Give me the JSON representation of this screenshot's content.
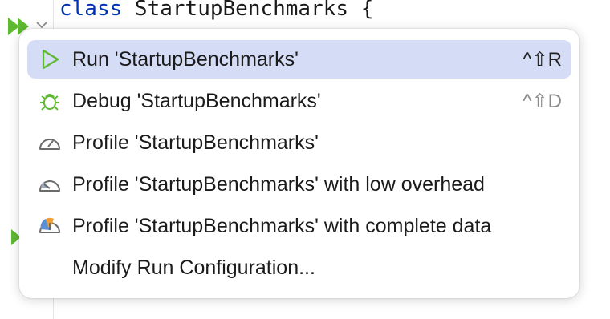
{
  "editor": {
    "code_keyword": "class",
    "code_rest": " StartupBenchmarks {",
    "closing_brace": "}"
  },
  "menu": {
    "items": [
      {
        "label": "Run 'StartupBenchmarks'",
        "shortcut": "^⇧R",
        "icon": "run-icon"
      },
      {
        "label": "Debug 'StartupBenchmarks'",
        "shortcut": "^⇧D",
        "icon": "debug-icon"
      },
      {
        "label": "Profile 'StartupBenchmarks'",
        "icon": "profile-icon"
      },
      {
        "label": "Profile 'StartupBenchmarks' with low overhead",
        "icon": "profile-low-overhead-icon"
      },
      {
        "label": "Profile 'StartupBenchmarks' with complete data",
        "icon": "profile-complete-data-icon"
      },
      {
        "label": "Modify Run Configuration..."
      }
    ],
    "selected_index": 0
  },
  "colors": {
    "selection": "#d4dcf6",
    "run_green": "#5fb832",
    "keyword_blue": "#0033b3"
  }
}
